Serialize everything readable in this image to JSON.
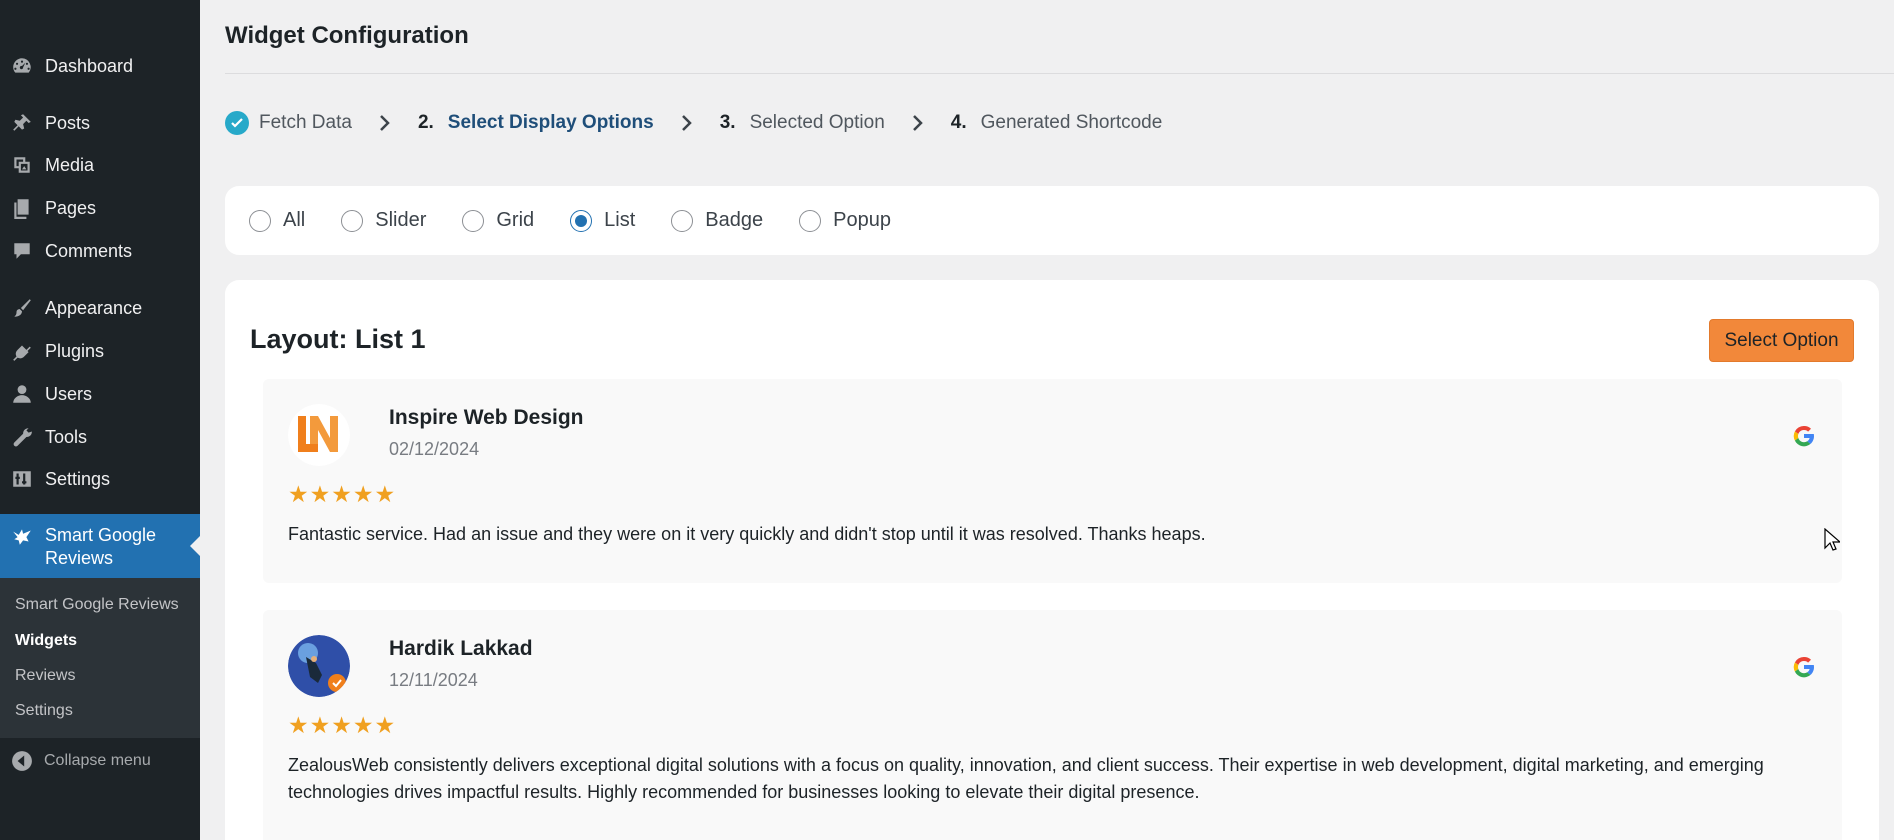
{
  "sidebar": {
    "items": [
      {
        "label": "Dashboard",
        "icon": "dashboard-icon"
      },
      {
        "label": "Posts",
        "icon": "pushpin-icon"
      },
      {
        "label": "Media",
        "icon": "media-icon"
      },
      {
        "label": "Pages",
        "icon": "pages-icon"
      },
      {
        "label": "Comments",
        "icon": "comments-icon"
      },
      {
        "label": "Appearance",
        "icon": "paintbrush-icon"
      },
      {
        "label": "Plugins",
        "icon": "plugin-icon"
      },
      {
        "label": "Users",
        "icon": "users-icon"
      },
      {
        "label": "Tools",
        "icon": "wrench-icon"
      },
      {
        "label": "Settings",
        "icon": "settings-sliders-icon"
      },
      {
        "label": "Smart Google Reviews",
        "icon": "bird-icon"
      }
    ],
    "submenu": [
      "Smart Google Reviews",
      "Widgets",
      "Reviews",
      "Settings"
    ],
    "submenu_current": "Widgets",
    "collapse_label": "Collapse menu"
  },
  "page": {
    "title": "Widget Configuration"
  },
  "steps": [
    {
      "num": "",
      "label": "Fetch Data",
      "state": "done"
    },
    {
      "num": "2.",
      "label": "Select Display Options",
      "state": "active"
    },
    {
      "num": "3.",
      "label": "Selected Option",
      "state": "pending"
    },
    {
      "num": "4.",
      "label": "Generated Shortcode",
      "state": "pending"
    }
  ],
  "display_options": {
    "options": [
      "All",
      "Slider",
      "Grid",
      "List",
      "Badge",
      "Popup"
    ],
    "selected": "List"
  },
  "layout": {
    "title": "Layout: List 1",
    "select_button": "Select Option"
  },
  "reviews": [
    {
      "name": "Inspire Web Design",
      "date": "02/12/2024",
      "rating": 5,
      "stars": "★★★★★",
      "text": "Fantastic service. Had an issue and they were on it very quickly and didn't stop until it was resolved. Thanks heaps."
    },
    {
      "name": "Hardik Lakkad",
      "date": "12/11/2024",
      "rating": 5,
      "stars": "★★★★★",
      "text": "ZealousWeb consistently delivers exceptional digital solutions with a focus on quality, innovation, and client success. Their expertise in web development, digital marketing, and emerging technologies drives impactful results. Highly recommended for businesses looking to elevate their digital presence."
    }
  ],
  "colors": {
    "sidebar_bg": "#1d2327",
    "active_menu": "#2271b1",
    "accent_button": "#f2883a",
    "star": "#f0a020",
    "step_done": "#27a9c9"
  }
}
